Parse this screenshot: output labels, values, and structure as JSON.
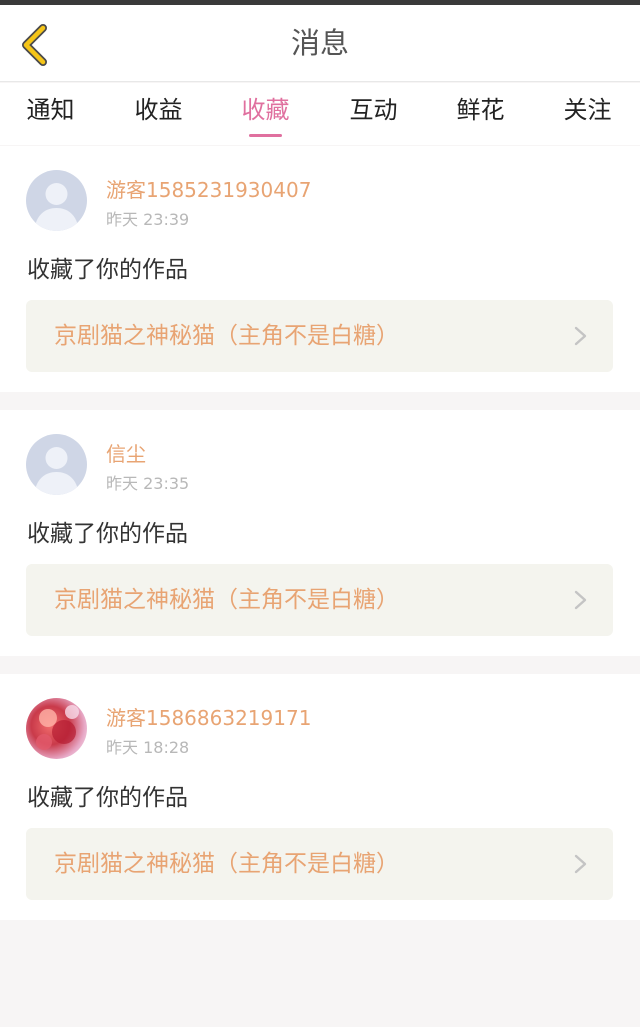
{
  "header": {
    "title": "消息",
    "back_icon": "chevron-left-icon",
    "back_color": "#f5c518"
  },
  "tabs": [
    {
      "label": "通知",
      "active": false
    },
    {
      "label": "收益",
      "active": false
    },
    {
      "label": "收藏",
      "active": true
    },
    {
      "label": "互动",
      "active": false
    },
    {
      "label": "鲜花",
      "active": false
    },
    {
      "label": "关注",
      "active": false
    }
  ],
  "accent_color": "#e0709f",
  "messages": [
    {
      "user": "游客1585231930407",
      "time": "昨天 23:39",
      "action": "收藏了你的作品",
      "work": "京剧猫之神秘猫（主角不是白糖）",
      "avatar": "default-avatar"
    },
    {
      "user": "信尘",
      "time": "昨天 23:35",
      "action": "收藏了你的作品",
      "work": "京剧猫之神秘猫（主角不是白糖）",
      "avatar": "default-avatar"
    },
    {
      "user": "游客1586863219171",
      "time": "昨天 18:28",
      "action": "收藏了你的作品",
      "work": "京剧猫之神秘猫（主角不是白糖）",
      "avatar": "photo-avatar"
    }
  ]
}
